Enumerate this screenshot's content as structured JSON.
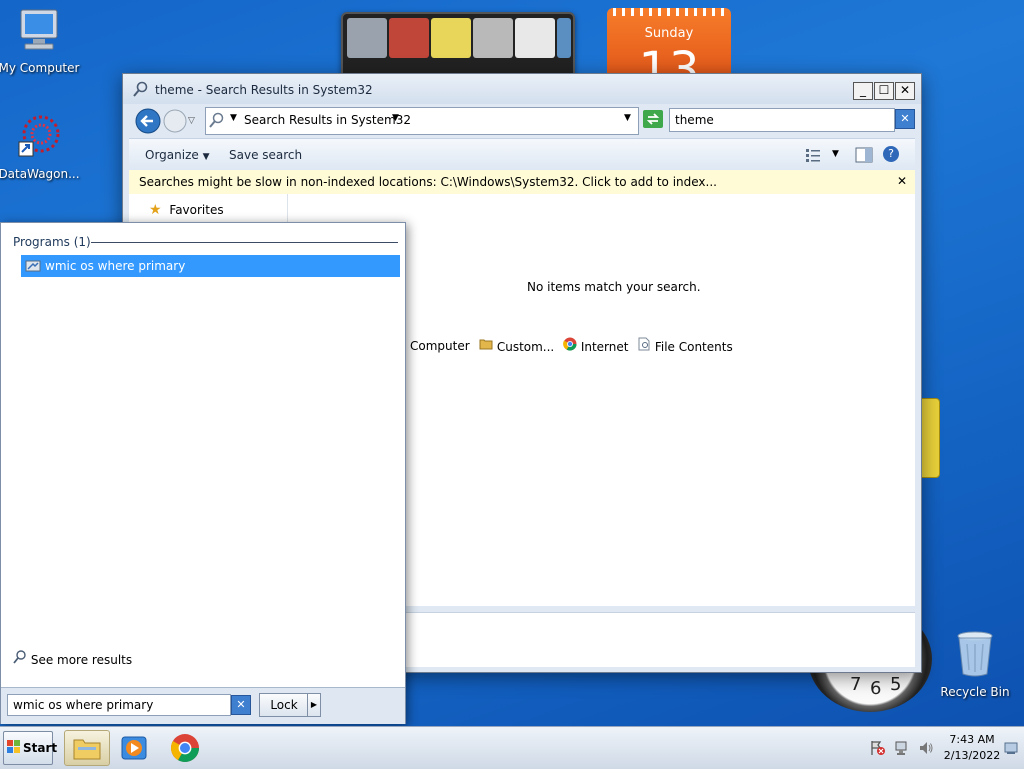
{
  "desktop": {
    "icons": [
      {
        "label": "My Computer",
        "icon": "computer-icon"
      },
      {
        "label": "DataWagon...",
        "icon": "datawagon-icon"
      },
      {
        "label": "Recycle Bin",
        "icon": "recycle-bin-icon"
      }
    ],
    "calendar": {
      "day_name": "Sunday",
      "day_number": "13"
    },
    "clock": {
      "numerals": [
        "7",
        "6",
        "5"
      ]
    }
  },
  "explorer": {
    "title": "theme - Search Results in System32",
    "controls": {
      "minimize": "_",
      "maximize": "☐",
      "close": "✕"
    },
    "address": "Search Results in System32",
    "search": {
      "value": "theme",
      "clear": "✕"
    },
    "toolbar": {
      "organize": "Organize",
      "save_search": "Save search"
    },
    "info_bar": "Searches might be slow in non-indexed locations: C:\\Windows\\System32. Click to add to index...",
    "info_close": "✕",
    "nav": {
      "favorites": "Favorites"
    },
    "empty_message": "No items match your search.",
    "search_again": [
      {
        "label": "Computer",
        "icon": "computer-icon"
      },
      {
        "label": "Custom...",
        "icon": "folder-icon"
      },
      {
        "label": "Internet",
        "icon": "chrome-icon"
      },
      {
        "label": "File Contents",
        "icon": "document-icon"
      }
    ]
  },
  "start_menu": {
    "group_header": "Programs (1)",
    "results": [
      {
        "label": "wmic os where primary",
        "icon": "program-icon",
        "selected": true
      }
    ],
    "see_more": "See more results",
    "search_value": "wmic os where primary",
    "lock_label": "Lock",
    "arrow": "▶"
  },
  "taskbar": {
    "start_label": "Start",
    "pinned": [
      "file-explorer-icon",
      "media-player-icon",
      "chrome-icon"
    ],
    "time": "7:43 AM",
    "date": "2/13/2022"
  },
  "colors": {
    "selection": "#3399ff",
    "info_bar": "#fefbd6",
    "desktop": "#1a6fce"
  }
}
